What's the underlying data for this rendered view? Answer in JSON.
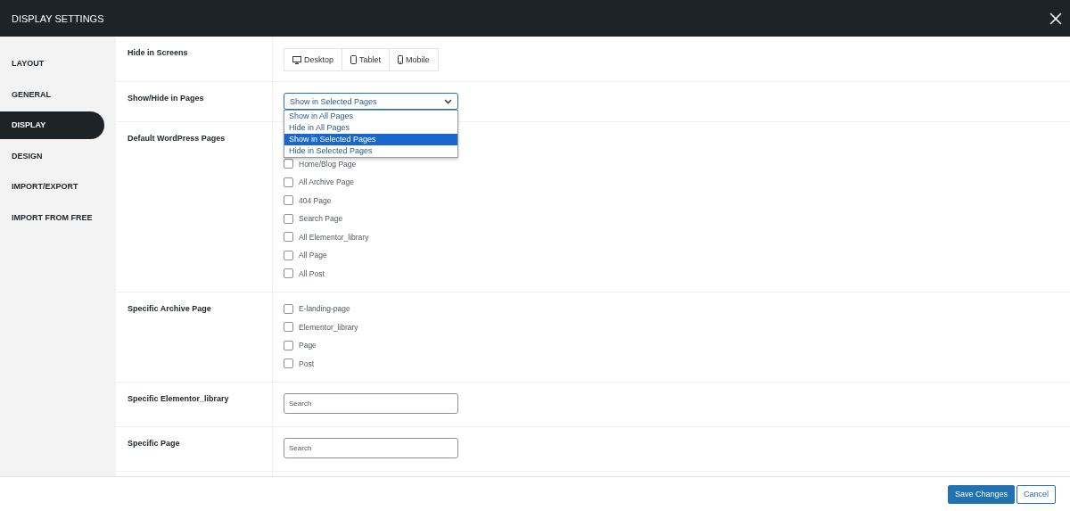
{
  "window": {
    "title": "DISPLAY SETTINGS"
  },
  "sidebar": {
    "items": [
      {
        "label": "LAYOUT",
        "selected": false
      },
      {
        "label": "GENERAL",
        "selected": false
      },
      {
        "label": "DISPLAY",
        "selected": true
      },
      {
        "label": "DESIGN",
        "selected": false
      },
      {
        "label": "IMPORT/EXPORT",
        "selected": false
      },
      {
        "label": "IMPORT FROM FREE",
        "selected": false
      }
    ]
  },
  "settings": [
    {
      "kind": "screens",
      "label": "Hide in Screens",
      "buttons": [
        {
          "kind": "desktop",
          "label": "Desktop"
        },
        {
          "kind": "tablet",
          "label": "Tablet"
        },
        {
          "kind": "mobile",
          "label": "Mobile"
        }
      ]
    },
    {
      "kind": "select",
      "label": "Show/Hide in Pages",
      "value": "Show in Selected Pages",
      "options": [
        {
          "label": "Show in All Pages",
          "selected": false
        },
        {
          "label": "Hide in All Pages",
          "selected": false
        },
        {
          "label": "Show in Selected Pages",
          "selected": true
        },
        {
          "label": "Hide in Selected Pages",
          "selected": false
        }
      ]
    },
    {
      "kind": "checkboxes",
      "label": "Default WordPress Pages",
      "items": [
        {
          "label": "Home/Blog Page",
          "checked": false
        },
        {
          "label": "All Archive Page",
          "checked": false
        },
        {
          "label": "404 Page",
          "checked": false
        },
        {
          "label": "Search Page",
          "checked": false
        },
        {
          "label": "All Elementor_library",
          "checked": false
        },
        {
          "label": "All Page",
          "checked": false
        },
        {
          "label": "All Post",
          "checked": false
        }
      ]
    },
    {
      "kind": "checkboxes",
      "label": "Specific Archive Page",
      "items": [
        {
          "label": "E-landing-page",
          "checked": false
        },
        {
          "label": "Elementor_library",
          "checked": false
        },
        {
          "label": "Page",
          "checked": false
        },
        {
          "label": "Post",
          "checked": false
        }
      ]
    },
    {
      "kind": "search",
      "label": "Specific Elementor_library",
      "placeholder": "Search"
    },
    {
      "kind": "search",
      "label": "Specific Page",
      "placeholder": "Search"
    }
  ],
  "footer": {
    "buttons": [
      {
        "kind": "primary",
        "label": "Save Changes"
      },
      {
        "kind": "secondary",
        "label": "Cancel"
      }
    ]
  }
}
